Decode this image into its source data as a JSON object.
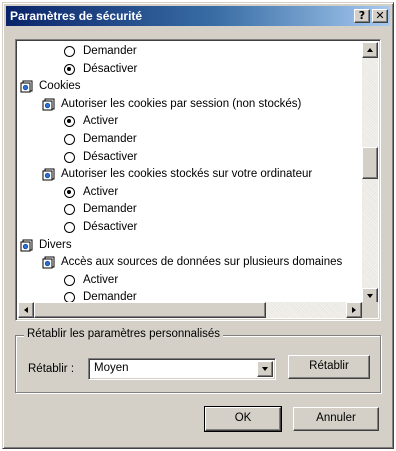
{
  "window": {
    "title": "Paramètres de sécurité",
    "help_glyph": "?",
    "close_glyph": "✕"
  },
  "settings_list": {
    "rows": [
      {
        "kind": "radio",
        "level": 2,
        "checked": false,
        "label": "Demander"
      },
      {
        "kind": "radio",
        "level": 2,
        "checked": true,
        "label": "Désactiver"
      },
      {
        "kind": "folder",
        "level": 0,
        "label": "Cookies"
      },
      {
        "kind": "folder",
        "level": 1,
        "label": "Autoriser les cookies par session (non stockés)"
      },
      {
        "kind": "radio",
        "level": 2,
        "checked": true,
        "label": "Activer"
      },
      {
        "kind": "radio",
        "level": 2,
        "checked": false,
        "label": "Demander"
      },
      {
        "kind": "radio",
        "level": 2,
        "checked": false,
        "label": "Désactiver"
      },
      {
        "kind": "folder",
        "level": 1,
        "label": "Autoriser les cookies stockés sur votre ordinateur"
      },
      {
        "kind": "radio",
        "level": 2,
        "checked": true,
        "label": "Activer"
      },
      {
        "kind": "radio",
        "level": 2,
        "checked": false,
        "label": "Demander"
      },
      {
        "kind": "radio",
        "level": 2,
        "checked": false,
        "label": "Désactiver"
      },
      {
        "kind": "folder",
        "level": 0,
        "label": "Divers"
      },
      {
        "kind": "folder",
        "level": 1,
        "label": "Accès aux sources de données sur plusieurs domaines"
      },
      {
        "kind": "radio",
        "level": 2,
        "checked": false,
        "label": "Activer"
      },
      {
        "kind": "radio",
        "level": 2,
        "checked": false,
        "label": "Demander"
      }
    ],
    "vertical_scroll_fraction": 0.45,
    "horizontal_scroll_fraction": 0.0
  },
  "reset_group": {
    "legend": "Rétablir les paramètres personnalisés",
    "label": "Rétablir :",
    "selected_level": "Moyen",
    "reset_button": "Rétablir"
  },
  "buttons": {
    "ok": "OK",
    "cancel": "Annuler"
  }
}
